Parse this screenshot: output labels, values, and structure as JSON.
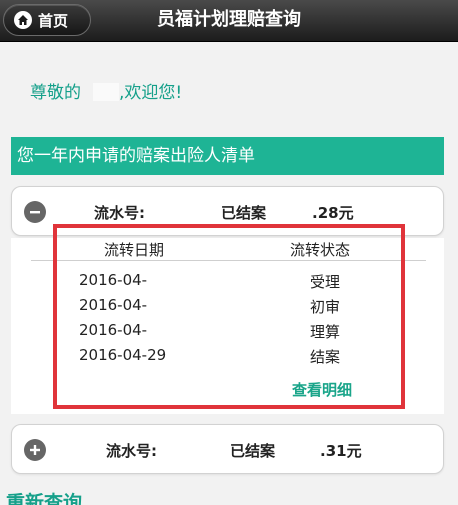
{
  "header": {
    "home_label": "首页",
    "title": "员福计划理赔查询"
  },
  "greeting": {
    "prefix": "尊敬的",
    "suffix": ",欢迎您!"
  },
  "banner": {
    "text": "您一年内申请的赔案出险人清单"
  },
  "claims": [
    {
      "toggle_icon": "minus-circle-icon",
      "serial_label": "流水号:",
      "status": "已结案",
      "amount": ".28元",
      "expanded": true,
      "columns": [
        "流转日期",
        "流转状态"
      ],
      "flow": [
        {
          "date": "2016-04-",
          "state": "受理"
        },
        {
          "date": "2016-04-",
          "state": "初审"
        },
        {
          "date": "2016-04-",
          "state": "理算"
        },
        {
          "date": "2016-04-29",
          "state": "结案"
        }
      ],
      "view_label": "查看明细"
    },
    {
      "toggle_icon": "plus-circle-icon",
      "serial_label": "流水号:",
      "status": "已结案",
      "amount": ".31元",
      "expanded": false
    }
  ],
  "requery_label": "重新查询",
  "colors": {
    "accent": "#1eb495",
    "highlight": "#e0343a"
  }
}
